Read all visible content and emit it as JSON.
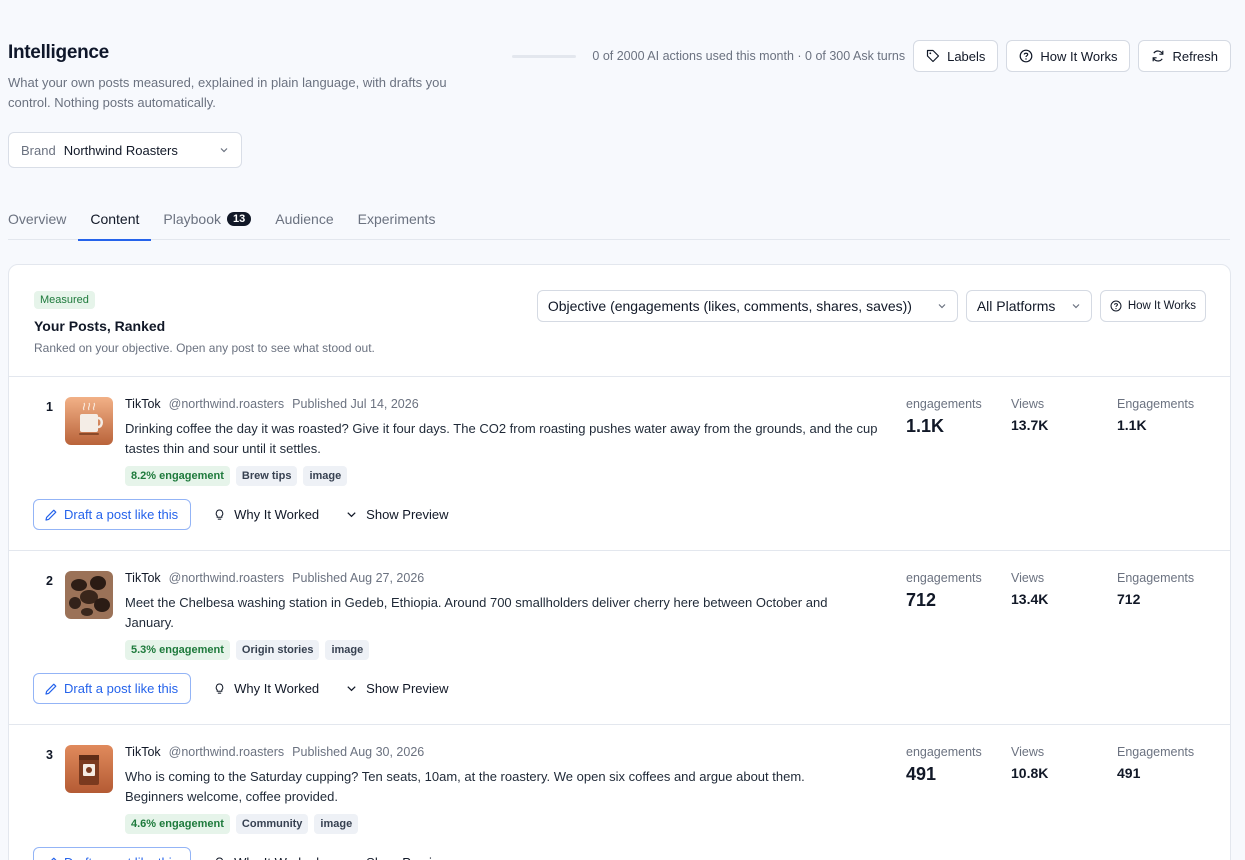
{
  "header": {
    "title": "Intelligence",
    "subtitle": "What your own posts measured, explained in plain language, with drafts you control. Nothing posts automatically."
  },
  "brand": {
    "label": "Brand",
    "value": "Northwind Roasters"
  },
  "usage": {
    "text": "0 of 2000 AI actions used this month · 0 of 300 Ask turns",
    "fraction": 0
  },
  "toolbar": {
    "labels": "Labels",
    "how_it_works": "How It Works",
    "refresh": "Refresh"
  },
  "tabs": [
    {
      "label": "Overview"
    },
    {
      "label": "Content",
      "active": true
    },
    {
      "label": "Playbook",
      "badge": "13"
    },
    {
      "label": "Audience"
    },
    {
      "label": "Experiments"
    }
  ],
  "panel": {
    "badge": "Measured",
    "title": "Your Posts, Ranked",
    "subtitle": "Ranked on your objective. Open any post to see what stood out.",
    "objective": "Objective (engagements (likes, comments, shares, saves))",
    "platform": "All Platforms",
    "how_it_works": "How It Works"
  },
  "labels": {
    "draft": "Draft a post like this",
    "why": "Why It Worked",
    "preview": "Show Preview",
    "m1": "engagements",
    "m2": "Views",
    "m3": "Engagements"
  },
  "posts": [
    {
      "rank": "1",
      "platform": "TikTok",
      "handle": "@northwind.roasters",
      "published": "Published Jul 14, 2026",
      "caption": "Drinking coffee the day it was roasted? Give it four days. The CO2 from roasting pushes water away from the grounds, and the cup tastes thin and sour until it settles.",
      "engagement_rate": "8.2% engagement",
      "topic": "Brew tips",
      "format": "image",
      "engagements_big": "1.1K",
      "views": "13.7K",
      "engagements": "1.1K",
      "thumb": "coffee-cup"
    },
    {
      "rank": "2",
      "platform": "TikTok",
      "handle": "@northwind.roasters",
      "published": "Published Aug 27, 2026",
      "caption": "Meet the Chelbesa washing station in Gedeb, Ethiopia. Around 700 smallholders deliver cherry here between October and January.",
      "engagement_rate": "5.3% engagement",
      "topic": "Origin stories",
      "format": "image",
      "engagements_big": "712",
      "views": "13.4K",
      "engagements": "712",
      "thumb": "coffee-beans"
    },
    {
      "rank": "3",
      "platform": "TikTok",
      "handle": "@northwind.roasters",
      "published": "Published Aug 30, 2026",
      "caption": "Who is coming to the Saturday cupping? Ten seats, 10am, at the roastery. We open six coffees and argue about them. Beginners welcome, coffee provided.",
      "engagement_rate": "4.6% engagement",
      "topic": "Community",
      "format": "image",
      "engagements_big": "491",
      "views": "10.8K",
      "engagements": "491",
      "thumb": "coffee-bag"
    }
  ],
  "colors": {
    "accent": "#2563eb",
    "success_bg": "#e6f4ea",
    "success_text": "#1e7a3c"
  }
}
